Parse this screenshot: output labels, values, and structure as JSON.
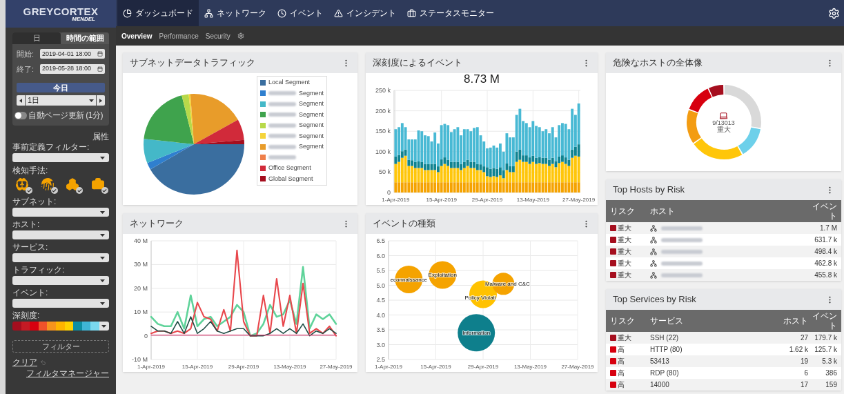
{
  "logo": {
    "brand": "GREYCORTEX",
    "product": "MENDEL"
  },
  "nav": {
    "tabs": [
      {
        "label": "ダッシュボード",
        "kind": "pie",
        "selected": true
      },
      {
        "label": "ネットワーク",
        "kind": "network",
        "selected": false
      },
      {
        "label": "イベント",
        "kind": "clock",
        "selected": false
      },
      {
        "label": "インシデント",
        "kind": "warning",
        "selected": false
      },
      {
        "label": "ステータスモニター",
        "kind": "monitor",
        "selected": false
      }
    ],
    "subtabs": [
      {
        "label": "Overview",
        "selected": true
      },
      {
        "label": "Performance",
        "selected": false
      },
      {
        "label": "Security",
        "selected": false
      }
    ]
  },
  "sidebar": {
    "range_tabs": [
      {
        "label": "日",
        "selected": false
      },
      {
        "label": "時間の範囲",
        "selected": true
      }
    ],
    "fields": [
      {
        "label": "開始:",
        "value": "2019-04-01 18:00"
      },
      {
        "label": "終了:",
        "value": "2019-05-28 18:00"
      }
    ],
    "today_button": "今日",
    "period": "1日",
    "auto_refresh": {
      "label": "自動ページ更新 (1分)",
      "on": false
    },
    "attributes_link": "属性",
    "predefined_filter_label": "事前定義フィルター:",
    "detection_label": "検知手法:",
    "detection_methods": [
      {
        "kind": "brain",
        "checked": true
      },
      {
        "kind": "fingerprint",
        "checked": true
      },
      {
        "kind": "boxes",
        "checked": true
      },
      {
        "kind": "medkit",
        "checked": true
      }
    ],
    "filters": [
      {
        "label": "サブネット:"
      },
      {
        "label": "ホスト:"
      },
      {
        "label": "サービス:"
      },
      {
        "label": "トラフィック:"
      },
      {
        "label": "イベント:"
      }
    ],
    "severity": {
      "label": "深刻度:",
      "levels": [
        {
          "color": "#a50e1e"
        },
        {
          "color": "#c41a24"
        },
        {
          "color": "#d7000f"
        },
        {
          "color": "#f0522a"
        },
        {
          "color": "#f7941d"
        },
        {
          "color": "#ffb400"
        },
        {
          "color": "#ffd200"
        },
        {
          "color": "#0d8ea3"
        },
        {
          "color": "#3fb5d6"
        },
        {
          "color": "#7ad8ee"
        }
      ]
    },
    "filter_button": "フィルター",
    "clear_link": "クリア",
    "manager_link": "フィルタマネージャー"
  },
  "subnet_traffic": {
    "title": "サブネットデータトラフィック",
    "legend": [
      {
        "label": "Local Segment",
        "color": "#3a6e9f",
        "redacted": false
      },
      {
        "label": "Segment",
        "color": "#2f7fcf",
        "redacted": true
      },
      {
        "label": "Segment",
        "color": "#44b8c8",
        "redacted": true
      },
      {
        "label": "Segment",
        "color": "#3fa34d",
        "redacted": true
      },
      {
        "label": "Segment",
        "color": "#b8d94a",
        "redacted": true
      },
      {
        "label": "Segment",
        "color": "#f5d43a",
        "redacted": true
      },
      {
        "label": "Segment",
        "color": "#e89c2a",
        "redacted": true
      },
      {
        "color": "#ef7f4a",
        "redacted": true
      },
      {
        "label": "Office Segment",
        "color": "#d12a3a",
        "redacted": false
      },
      {
        "label": "Global Segment",
        "color": "#a50e1e",
        "redacted": false
      }
    ]
  },
  "events_by_severity": {
    "title": "深刻度によるイベント",
    "total": "8.73 M",
    "chart_data": {
      "type": "bar",
      "stacked": true,
      "grid": true,
      "ylim": [
        0,
        250
      ],
      "categories": [
        "1-Apr-2019",
        null,
        null,
        null,
        null,
        null,
        null,
        null,
        null,
        null,
        null,
        null,
        null,
        null,
        "15-Apr-2019",
        null,
        null,
        null,
        null,
        null,
        null,
        null,
        null,
        null,
        null,
        null,
        null,
        null,
        "29-Apr-2019",
        null,
        null,
        null,
        null,
        null,
        null,
        null,
        null,
        null,
        null,
        null,
        null,
        null,
        "13-May-2019",
        null,
        null,
        null,
        null,
        null,
        null,
        null,
        null,
        null,
        null,
        null,
        null,
        null,
        "27-May-2019"
      ],
      "yticks": [
        {
          "value": 0,
          "label": "0"
        },
        {
          "value": 50,
          "label": "50 k"
        },
        {
          "value": 100,
          "label": "100 k"
        },
        {
          "value": 150,
          "label": "150 k"
        },
        {
          "value": 200,
          "label": "200 k"
        },
        {
          "value": 250,
          "label": "250 k"
        }
      ],
      "series": [
        {
          "color": "#f5a300",
          "values": [
            25,
            25,
            25,
            25,
            25,
            25,
            25,
            25,
            25,
            25,
            25,
            25,
            25,
            25,
            25,
            25,
            25,
            25,
            25,
            25,
            25,
            25,
            25,
            25,
            25,
            25,
            25,
            25,
            25,
            25,
            25,
            25,
            25,
            25,
            25,
            25,
            25,
            25,
            25,
            25,
            25,
            25,
            25,
            25,
            25,
            25,
            25,
            25,
            25,
            25,
            25,
            25,
            25,
            25,
            25,
            25,
            25
          ]
        },
        {
          "color": "#ffc60a",
          "values": [
            45,
            50,
            60,
            65,
            40,
            40,
            35,
            35,
            35,
            30,
            30,
            30,
            30,
            25,
            40,
            45,
            40,
            35,
            35,
            35,
            30,
            35,
            40,
            35,
            35,
            30,
            30,
            25,
            15,
            13,
            15,
            13,
            17,
            10,
            30,
            25,
            25,
            50,
            55,
            50,
            50,
            45,
            50,
            45,
            47,
            45,
            45,
            40,
            45,
            37,
            47,
            50,
            45,
            40,
            60,
            65,
            63
          ]
        },
        {
          "color": "#0f8391",
          "values": [
            18,
            17,
            16,
            15,
            15,
            14,
            15,
            16,
            15,
            15,
            15,
            15,
            15,
            14,
            16,
            16,
            15,
            15,
            15,
            15,
            15,
            15,
            15,
            15,
            15,
            15,
            14,
            14,
            22,
            20,
            20,
            20,
            20,
            20,
            16,
            15,
            15,
            25,
            25,
            16,
            16,
            16,
            15,
            15,
            15,
            15,
            15,
            15,
            15,
            15,
            16,
            16,
            16,
            15,
            20,
            22,
            30
          ]
        },
        {
          "color": "#48b9d4",
          "values": [
            67,
            68,
            69,
            55,
            50,
            51,
            55,
            76,
            75,
            70,
            68,
            55,
            77,
            56,
            84,
            82,
            85,
            73,
            80,
            85,
            70,
            80,
            75,
            75,
            83,
            90,
            71,
            61,
            46,
            52,
            55,
            52,
            58,
            45,
            74,
            70,
            70,
            90,
            100,
            84,
            79,
            74,
            85,
            78,
            73,
            65,
            70,
            65,
            75,
            58,
            77,
            79,
            82,
            75,
            100,
            78,
            100
          ]
        }
      ]
    }
  },
  "network": {
    "title": "ネットワーク",
    "chart_data": {
      "type": "line",
      "grid": true,
      "ylim": [
        -10,
        40
      ],
      "categories": [
        "1-Apr-2019",
        null,
        null,
        null,
        null,
        null,
        null,
        "15-Apr-2019",
        null,
        null,
        null,
        null,
        null,
        null,
        "29-Apr-2019",
        null,
        null,
        null,
        null,
        null,
        null,
        "13-May-2019",
        null,
        null,
        null,
        null,
        null,
        null,
        "27-May-2019"
      ],
      "yticks": [
        {
          "value": -10,
          "label": "-10 M"
        },
        {
          "value": 0,
          "label": "0"
        },
        {
          "value": 10,
          "label": "10 M"
        },
        {
          "value": 20,
          "label": "20 M"
        },
        {
          "value": 30,
          "label": "30 M"
        },
        {
          "value": 40,
          "label": "40 M"
        }
      ],
      "series": [
        {
          "color": "#5fd39a",
          "values": [
            8,
            5,
            4,
            4,
            10,
            3,
            17,
            4,
            7,
            8,
            4,
            6,
            8,
            13,
            10,
            0,
            1,
            5,
            13,
            8,
            9,
            15,
            5,
            29,
            3,
            9,
            7,
            9,
            5
          ]
        },
        {
          "color": "#e8474c",
          "values": [
            1,
            2,
            2,
            1,
            2,
            1,
            3,
            14,
            8,
            7,
            2,
            11,
            2,
            36,
            6,
            0,
            0,
            17,
            1,
            24,
            4,
            17,
            1,
            22,
            1,
            3,
            1,
            4,
            0
          ]
        },
        {
          "color": "#1e4d45",
          "values": [
            4,
            2,
            2,
            1,
            6,
            1,
            8,
            1,
            3,
            6,
            2,
            1,
            2,
            3,
            3,
            0,
            0,
            0,
            1,
            3,
            1,
            3,
            1,
            5,
            0,
            2,
            1,
            3,
            1
          ]
        },
        {
          "color": "#d63a6e",
          "values": [
            0.3,
            0.3,
            0.3,
            0.3,
            0.3,
            0.3,
            0.3,
            0.3,
            0.3,
            0.3,
            0.3,
            0.3,
            0.3,
            0.3,
            0.3,
            0.3,
            0.3,
            0.3,
            0.3,
            0.3,
            0.3,
            0.3,
            0.3,
            0.3,
            0.3,
            0.3,
            0.3,
            0.3,
            0.3
          ]
        }
      ]
    }
  },
  "event_types": {
    "title": "イベントの種類",
    "chart_data": {
      "type": "scatter",
      "grid": true,
      "ylim": [
        2.5,
        6.5
      ],
      "categories": [
        "1-Apr-2019",
        null,
        null,
        null,
        null,
        null,
        null,
        "15-Apr-2019",
        null,
        null,
        null,
        null,
        null,
        null,
        "29-Apr-2019",
        null,
        null,
        null,
        null,
        null,
        null,
        "13-May-2019",
        null,
        null,
        null,
        null,
        null,
        null,
        "27-May-2019"
      ],
      "yticks": [
        {
          "value": 2.5,
          "label": "2.5"
        },
        {
          "value": 3,
          "label": "3.0"
        },
        {
          "value": 3.5,
          "label": "3.5"
        },
        {
          "value": 4,
          "label": "4.0"
        },
        {
          "value": 4.5,
          "label": "4.5"
        },
        {
          "value": 5,
          "label": "5.0"
        },
        {
          "value": 5.5,
          "label": "5.5"
        },
        {
          "value": 6,
          "label": "6.0"
        },
        {
          "value": 6.5,
          "label": "6.5"
        }
      ],
      "series": [
        {
          "name": "econnaissance",
          "color": "#f5a300",
          "values": [
            null,
            null,
            null,
            5.2,
            null,
            null,
            null,
            null,
            null,
            null,
            null,
            null,
            null,
            null,
            null,
            null,
            null,
            null,
            null,
            null,
            null,
            null,
            null,
            null,
            null,
            null,
            null,
            null,
            null
          ]
        },
        {
          "name": "Exploitation",
          "color": "#f5a300",
          "values": [
            null,
            null,
            null,
            null,
            null,
            null,
            null,
            null,
            5.35,
            null,
            null,
            null,
            null,
            null,
            null,
            null,
            null,
            null,
            null,
            null,
            null,
            null,
            null,
            null,
            null,
            null,
            null,
            null,
            null
          ]
        },
        {
          "name": "Policy Violati",
          "color": "#ffc200",
          "values": [
            null,
            null,
            null,
            null,
            null,
            null,
            null,
            null,
            null,
            null,
            null,
            null,
            null,
            null,
            4.7,
            null,
            null,
            null,
            null,
            null,
            null,
            null,
            null,
            null,
            null,
            null,
            null,
            null,
            null
          ]
        },
        {
          "name": "Malware and C&C",
          "color": "#f5a300",
          "values": [
            null,
            null,
            null,
            null,
            null,
            null,
            null,
            null,
            null,
            null,
            null,
            null,
            null,
            null,
            null,
            null,
            null,
            5.05,
            null,
            null,
            null,
            null,
            null,
            null,
            null,
            null,
            null,
            null,
            null
          ]
        },
        {
          "name": "Information",
          "color": "#0e7f8c",
          "values": [
            null,
            null,
            null,
            null,
            null,
            null,
            null,
            null,
            null,
            null,
            null,
            null,
            null,
            3.4,
            null,
            null,
            null,
            null,
            null,
            null,
            null,
            null,
            null,
            null,
            null,
            null,
            null,
            null,
            null
          ]
        }
      ]
    }
  },
  "risky_hosts": {
    "title": "危険なホストの全体像",
    "center_value": "9/13013",
    "center_label": "重大"
  },
  "top_hosts": {
    "title": "Top Hosts by Risk",
    "columns": [
      "リスク",
      "ホスト",
      "イベント"
    ],
    "rows": [
      {
        "risk": "重大",
        "color": "#a50e1e",
        "events": "1.7 M"
      },
      {
        "risk": "重大",
        "color": "#a50e1e",
        "events": "631.7 k"
      },
      {
        "risk": "重大",
        "color": "#a50e1e",
        "events": "498.4 k"
      },
      {
        "risk": "重大",
        "color": "#a50e1e",
        "events": "462.8 k"
      },
      {
        "risk": "重大",
        "color": "#a50e1e",
        "events": "455.8 k"
      }
    ]
  },
  "top_services": {
    "title": "Top Services by Risk",
    "columns": [
      "リスク",
      "サービス",
      "ホスト",
      "イベント"
    ],
    "rows": [
      {
        "risk": "重大",
        "color": "#a50e1e",
        "service": "SSH (22)",
        "hosts": "27",
        "events": "179.7 k"
      },
      {
        "risk": "高",
        "color": "#d7000f",
        "service": "HTTP (80)",
        "hosts": "1.62 k",
        "events": "125.7 k"
      },
      {
        "risk": "高",
        "color": "#d7000f",
        "service": "53413",
        "hosts": "19",
        "events": "5.3 k"
      },
      {
        "risk": "高",
        "color": "#d7000f",
        "service": "RDP (80)",
        "hosts": "6",
        "events": "386"
      },
      {
        "risk": "高",
        "color": "#d7000f",
        "service": "14000",
        "hosts": "17",
        "events": "159"
      }
    ]
  }
}
